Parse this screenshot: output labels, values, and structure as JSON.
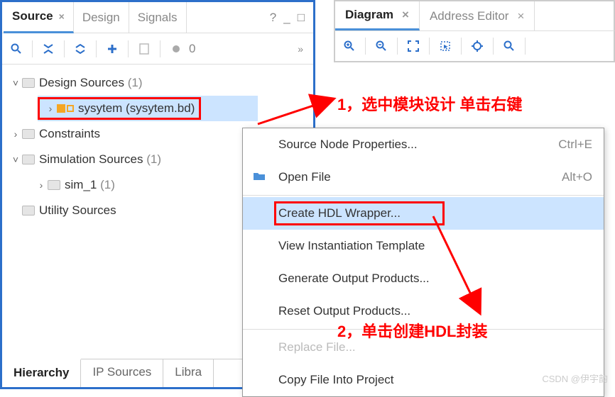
{
  "left": {
    "tabs": {
      "source": "Source",
      "design": "Design",
      "signals": "Signals"
    },
    "help": "?",
    "toolbar": {
      "radio_count": "0"
    },
    "tree": {
      "design_sources": "Design Sources",
      "design_sources_count": "(1)",
      "system_item": "sysytem (sysytem.bd)",
      "constraints": "Constraints",
      "simulation_sources": "Simulation Sources",
      "simulation_sources_count": "(1)",
      "sim1": "sim_1",
      "sim1_count": "(1)",
      "utility_sources": "Utility Sources"
    },
    "bottom_tabs": {
      "hierarchy": "Hierarchy",
      "ip_sources": "IP Sources",
      "libraries": "Libra"
    }
  },
  "right": {
    "tabs": {
      "diagram": "Diagram",
      "addr_editor": "Address Editor"
    }
  },
  "menu": {
    "source_node_props": "Source Node Properties...",
    "source_node_props_sc": "Ctrl+E",
    "open_file": "Open File",
    "open_file_sc": "Alt+O",
    "create_hdl_wrapper": "Create HDL Wrapper...",
    "view_inst_template": "View Instantiation Template",
    "generate_output": "Generate Output Products...",
    "reset_output": "Reset Output Products...",
    "replace_file": "Replace File...",
    "copy_file": "Copy File Into Project"
  },
  "annotations": {
    "a1": "1，选中模块设计 单击右键",
    "a2": "2，单击创建HDL封装"
  },
  "watermark": "CSDN @伊宇韵"
}
